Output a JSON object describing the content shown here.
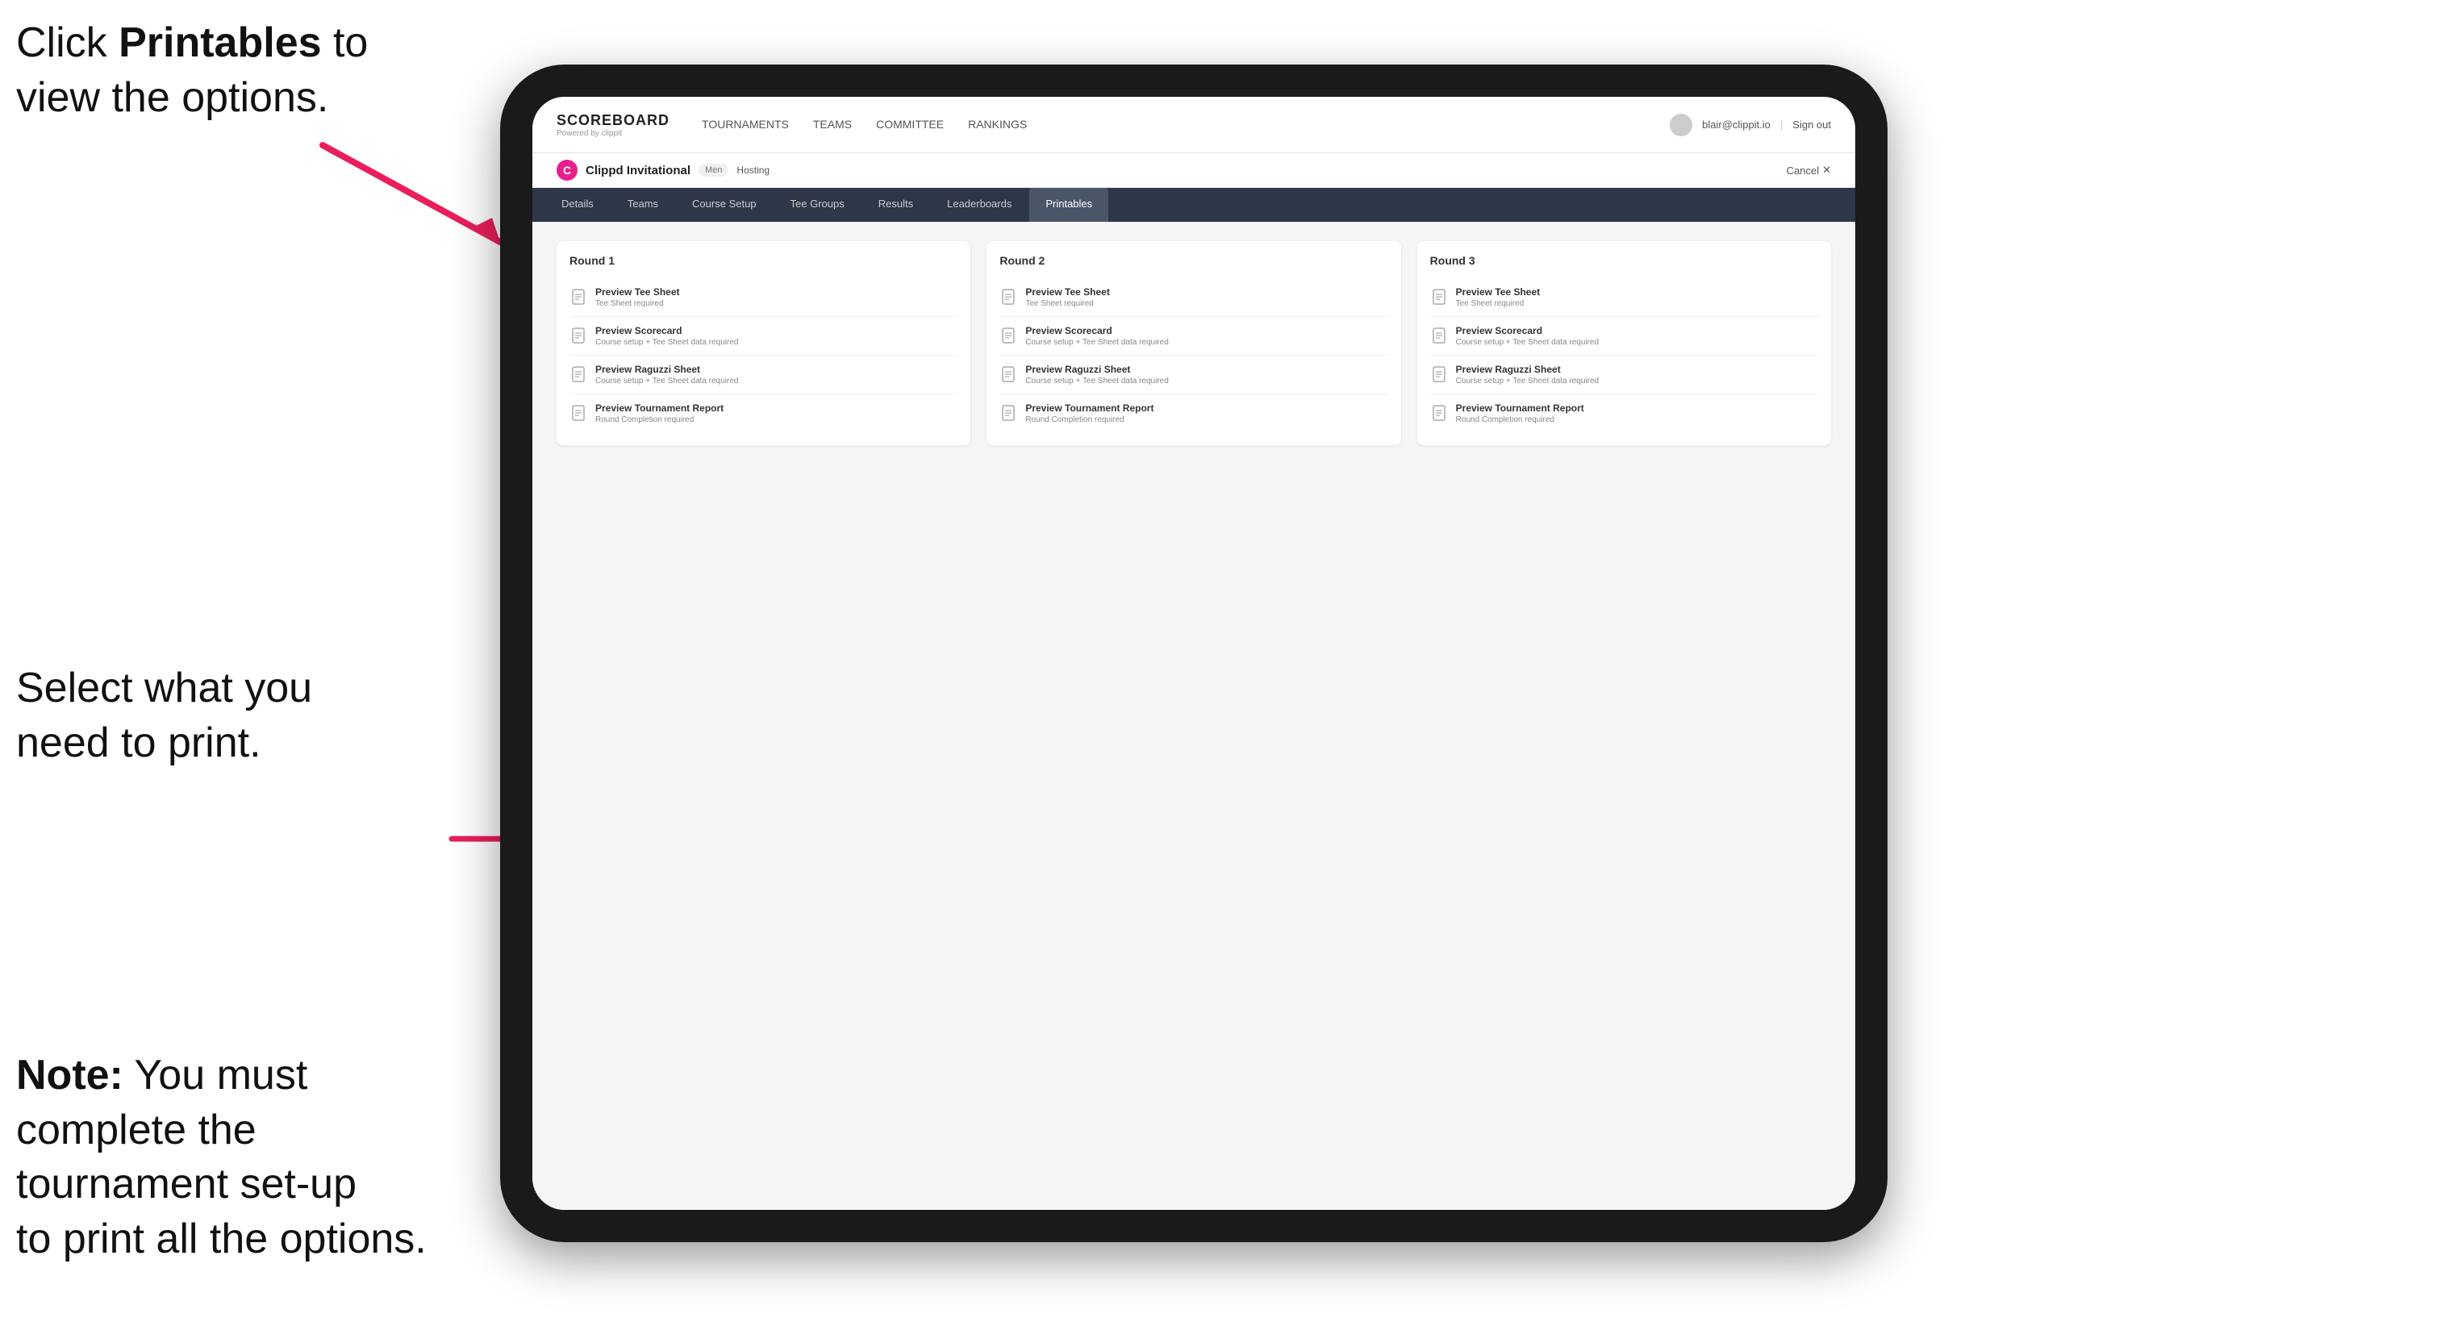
{
  "annotations": {
    "top": {
      "prefix": "Click ",
      "bold": "Printables",
      "suffix": " to\nview the options."
    },
    "middle": "Select what you\nneed to print.",
    "bottom": {
      "prefix_bold": "Note:",
      "suffix": " You must\ncomplete the\ntournament set-up\nto print all the options."
    }
  },
  "nav": {
    "brand_title": "SCOREBOARD",
    "brand_sub": "Powered by clippit",
    "links": [
      {
        "label": "TOURNAMENTS",
        "active": false
      },
      {
        "label": "TEAMS",
        "active": false
      },
      {
        "label": "COMMITTEE",
        "active": false
      },
      {
        "label": "RANKINGS",
        "active": false
      }
    ],
    "user_email": "blair@clippit.io",
    "sign_out": "Sign out"
  },
  "tournament": {
    "logo": "C",
    "name": "Clippd Invitational",
    "badge": "Men",
    "status": "Hosting",
    "cancel": "Cancel"
  },
  "tabs": [
    {
      "label": "Details",
      "active": false
    },
    {
      "label": "Teams",
      "active": false
    },
    {
      "label": "Course Setup",
      "active": false
    },
    {
      "label": "Tee Groups",
      "active": false
    },
    {
      "label": "Results",
      "active": false
    },
    {
      "label": "Leaderboards",
      "active": false
    },
    {
      "label": "Printables",
      "active": true
    }
  ],
  "rounds": [
    {
      "title": "Round 1",
      "items": [
        {
          "title": "Preview Tee Sheet",
          "subtitle": "Tee Sheet required"
        },
        {
          "title": "Preview Scorecard",
          "subtitle": "Course setup + Tee Sheet data required"
        },
        {
          "title": "Preview Raguzzi Sheet",
          "subtitle": "Course setup + Tee Sheet data required"
        },
        {
          "title": "Preview Tournament Report",
          "subtitle": "Round Completion required"
        }
      ]
    },
    {
      "title": "Round 2",
      "items": [
        {
          "title": "Preview Tee Sheet",
          "subtitle": "Tee Sheet required"
        },
        {
          "title": "Preview Scorecard",
          "subtitle": "Course setup + Tee Sheet data required"
        },
        {
          "title": "Preview Raguzzi Sheet",
          "subtitle": "Course setup + Tee Sheet data required"
        },
        {
          "title": "Preview Tournament Report",
          "subtitle": "Round Completion required"
        }
      ]
    },
    {
      "title": "Round 3",
      "items": [
        {
          "title": "Preview Tee Sheet",
          "subtitle": "Tee Sheet required"
        },
        {
          "title": "Preview Scorecard",
          "subtitle": "Course setup + Tee Sheet data required"
        },
        {
          "title": "Preview Raguzzi Sheet",
          "subtitle": "Course setup + Tee Sheet data required"
        },
        {
          "title": "Preview Tournament Report",
          "subtitle": "Round Completion required"
        }
      ]
    }
  ]
}
